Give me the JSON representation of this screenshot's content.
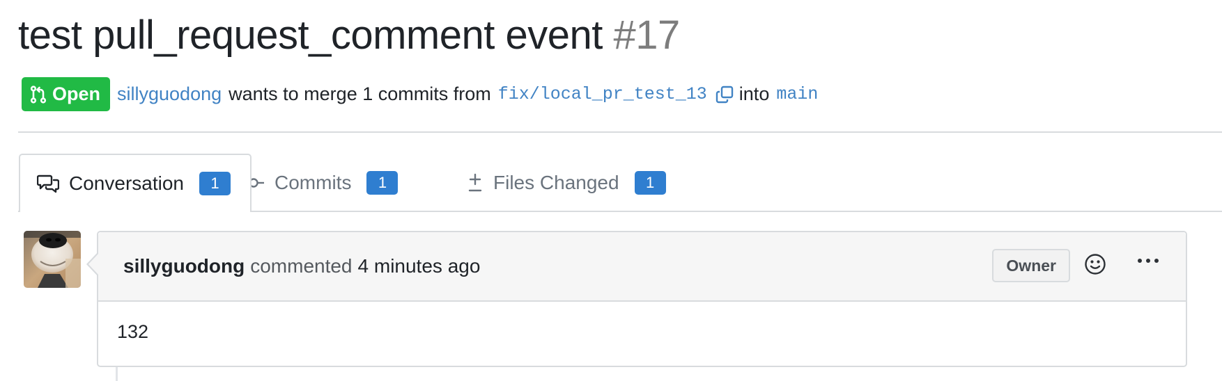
{
  "pr": {
    "title": "test pull_request_comment event",
    "number": "#17",
    "status_label": "Open",
    "author": "sillyguodong",
    "merge_text": "wants to merge 1 commits from",
    "head_branch": "fix/local_pr_test_13",
    "into_text": "into",
    "base_branch": "main"
  },
  "tabs": [
    {
      "label": "Conversation",
      "count": "1",
      "icon": "conversation-icon",
      "active": true
    },
    {
      "label": "Commits",
      "count": "1",
      "icon": "commit-icon",
      "active": false
    },
    {
      "label": "Files Changed",
      "count": "1",
      "icon": "diff-icon",
      "active": false
    }
  ],
  "comment": {
    "author": "sillyguodong",
    "action": "commented",
    "time": "4 minutes ago",
    "role_badge": "Owner",
    "body": "132",
    "avatar": "dog-avatar"
  },
  "icons": {
    "status": "git-pull-request-icon",
    "copy": "copy-icon",
    "reaction": "smiley-icon",
    "menu": "kebab-horizontal-icon"
  },
  "colors": {
    "open_green": "#21ba45",
    "link_blue": "#4183c4",
    "count_blue": "#2f7ed0",
    "header_bg": "#f6f6f6",
    "border": "#d8dbde"
  }
}
